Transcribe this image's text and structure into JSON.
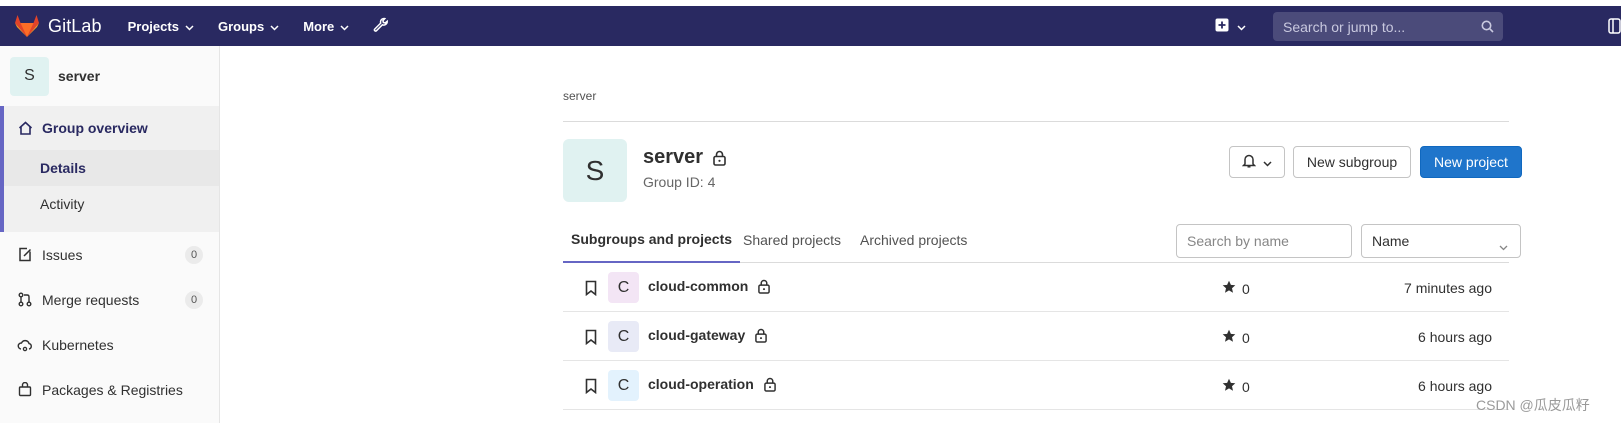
{
  "navbar": {
    "brand": "GitLab",
    "menu": [
      {
        "label": "Projects"
      },
      {
        "label": "Groups"
      },
      {
        "label": "More"
      }
    ],
    "search_placeholder": "Search or jump to...",
    "colors": {
      "background": "#292961"
    }
  },
  "sidebar": {
    "group_initial": "S",
    "group_name": "server",
    "overview": {
      "label": "Group overview",
      "subitems": [
        {
          "label": "Details"
        },
        {
          "label": "Activity"
        }
      ]
    },
    "items": [
      {
        "label": "Issues",
        "count": "0"
      },
      {
        "label": "Merge requests",
        "count": "0"
      },
      {
        "label": "Kubernetes"
      },
      {
        "label": "Packages & Registries"
      }
    ]
  },
  "main": {
    "breadcrumb": "server",
    "group": {
      "initial": "S",
      "name": "server",
      "id_text": "Group ID: 4"
    },
    "buttons": {
      "new_subgroup": "New subgroup",
      "new_project": "New project"
    },
    "tabs": [
      {
        "label": "Subgroups and projects"
      },
      {
        "label": "Shared projects"
      },
      {
        "label": "Archived projects"
      }
    ],
    "filter_placeholder": "Search by name",
    "sort_value": "Name",
    "projects": [
      {
        "initial": "C",
        "name": "cloud-common",
        "stars": "0",
        "updated": "7 minutes ago",
        "avatar_color": "#f3e5f5"
      },
      {
        "initial": "C",
        "name": "cloud-gateway",
        "stars": "0",
        "updated": "6 hours ago",
        "avatar_color": "#e8eaf6"
      },
      {
        "initial": "C",
        "name": "cloud-operation",
        "stars": "0",
        "updated": "6 hours ago",
        "avatar_color": "#e3f2fd"
      }
    ],
    "colors": {
      "primary": "#1f75cb",
      "accent": "#6666c4"
    }
  },
  "watermark": "CSDN @瓜皮瓜籽"
}
